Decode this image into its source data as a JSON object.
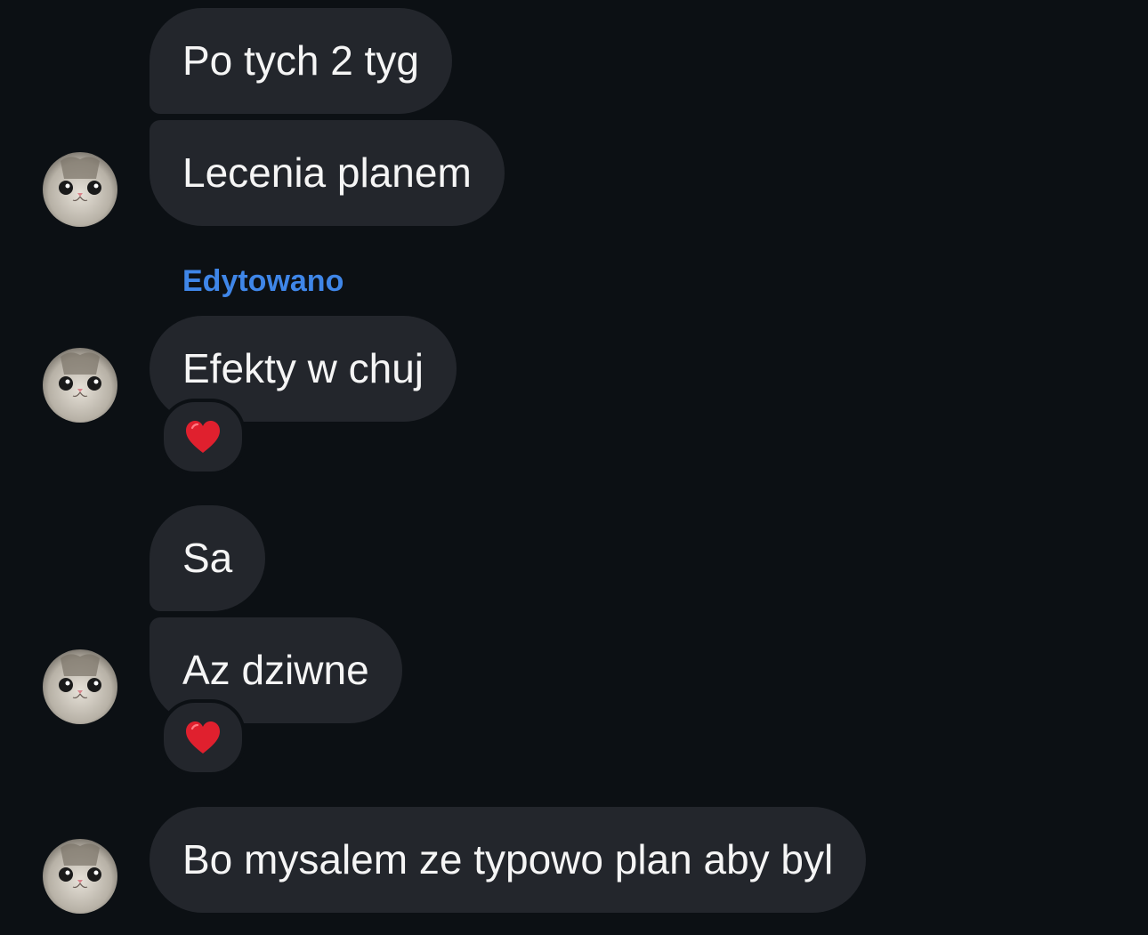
{
  "messages": [
    {
      "text": "Po tych 2 tyg"
    },
    {
      "text": "Lecenia planem"
    },
    {
      "text": "Efekty w chuj",
      "edited_label": "Edytowano",
      "reaction": "heart"
    },
    {
      "text": "Sa"
    },
    {
      "text": "Az dziwne",
      "reaction": "heart"
    },
    {
      "text": "Bo mysalem ze typowo plan aby byl"
    }
  ],
  "colors": {
    "background": "#0c1014",
    "bubble": "#23262c",
    "text": "#f5f5f5",
    "edited": "#3f86e8",
    "heart": "#e0202e"
  },
  "icons": {
    "avatar": "cat-avatar-icon",
    "reaction": "red-heart-icon"
  }
}
